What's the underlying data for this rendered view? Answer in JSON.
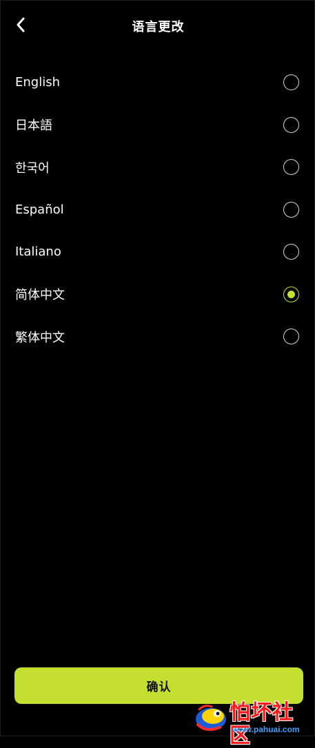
{
  "header": {
    "title": "语言更改",
    "back_icon": "chevron-left-icon"
  },
  "languages": [
    {
      "label": "English",
      "selected": false
    },
    {
      "label": "日本語",
      "selected": false
    },
    {
      "label": "한국어",
      "selected": false
    },
    {
      "label": "Español",
      "selected": false
    },
    {
      "label": "Italiano",
      "selected": false
    },
    {
      "label": "简体中文",
      "selected": true
    },
    {
      "label": "繁体中文",
      "selected": false
    }
  ],
  "confirm_label": "确认",
  "watermark": {
    "text": "怕坏社区",
    "url": "www.pahuai.com"
  },
  "colors": {
    "background": "#000000",
    "accent": "#c5df31",
    "text": "#ffffff"
  }
}
